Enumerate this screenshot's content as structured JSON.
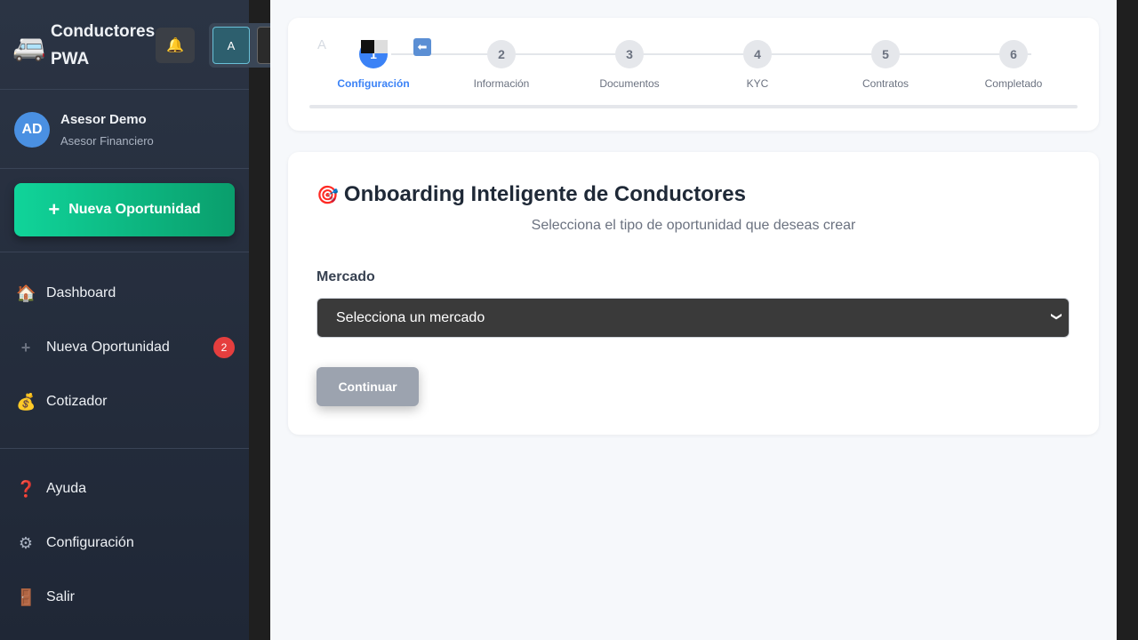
{
  "brand": {
    "title": "Conductores PWA",
    "icon": "bus-icon"
  },
  "user": {
    "initials": "AD",
    "name": "Asesor Demo",
    "role": "Asesor Financiero"
  },
  "sidebar": {
    "cta_label": "Nueva Oportunidad",
    "items": [
      {
        "label": "Dashboard",
        "icon": "house-icon"
      },
      {
        "label": "Nueva Oportunidad",
        "icon": "plus-icon",
        "badge": "2"
      },
      {
        "label": "Cotizador",
        "icon": "money-bag-icon"
      },
      {
        "label": "Ayuda",
        "icon": "question-icon"
      },
      {
        "label": "Configuración",
        "icon": "gear-icon"
      },
      {
        "label": "Salir",
        "icon": "door-icon"
      }
    ]
  },
  "toolbar": {
    "access_a": "A",
    "access_b": "A",
    "ghost_a": "A"
  },
  "stepper": {
    "steps": [
      {
        "num": "1",
        "label": "Configuración",
        "active": true
      },
      {
        "num": "2",
        "label": "Información"
      },
      {
        "num": "3",
        "label": "Documentos"
      },
      {
        "num": "4",
        "label": "KYC"
      },
      {
        "num": "5",
        "label": "Contratos"
      },
      {
        "num": "6",
        "label": "Completado"
      }
    ]
  },
  "form": {
    "title": "Onboarding Inteligente de Conductores",
    "subtitle": "Selecciona el tipo de oportunidad que deseas crear",
    "market_label": "Mercado",
    "market_placeholder": "Selecciona un mercado",
    "continue_label": "Continuar"
  },
  "colors": {
    "accent": "#3b82f6",
    "cta": "#10d49a",
    "badge": "#e53e3e"
  }
}
